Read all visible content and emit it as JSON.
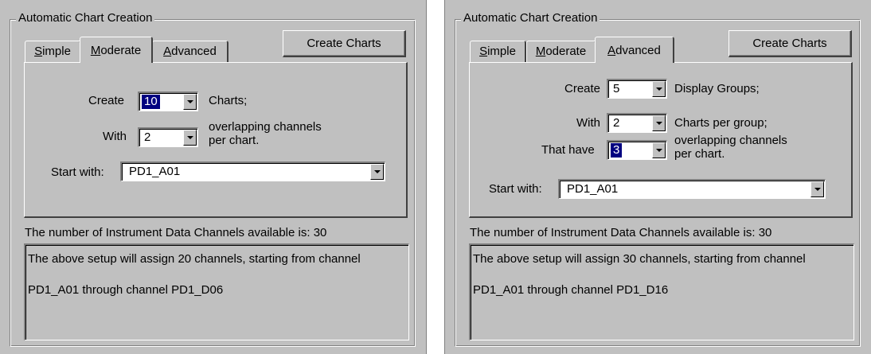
{
  "panels": [
    {
      "group_title": "Automatic Chart Creation",
      "tabs": [
        {
          "pre": "",
          "ul": "S",
          "post": "imple"
        },
        {
          "pre": "",
          "ul": "M",
          "post": "oderate"
        },
        {
          "pre": "",
          "ul": "A",
          "post": "dvanced"
        }
      ],
      "active_tab": "Moderate",
      "create_button": "Create Charts",
      "rows": {
        "create_label": "Create",
        "create_value": "10",
        "create_suffix": "Charts;",
        "with_label": "With",
        "with_value": "2",
        "with_suffix_line1": "overlapping channels",
        "with_suffix_line2": "per chart.",
        "start_label": "Start with:",
        "start_value": "PD1_A01"
      },
      "status": "The number of Instrument Data Channels available is: 30",
      "summary_line1": "The above setup will assign 20 channels, starting from channel",
      "summary_line2": "PD1_A01 through channel PD1_D06"
    },
    {
      "group_title": "Automatic Chart Creation",
      "tabs": [
        {
          "pre": "",
          "ul": "S",
          "post": "imple"
        },
        {
          "pre": "",
          "ul": "M",
          "post": "oderate"
        },
        {
          "pre": "",
          "ul": "A",
          "post": "dvanced"
        }
      ],
      "active_tab": "Advanced",
      "create_button": "Create Charts",
      "rows": {
        "create_label": "Create",
        "create_value": "5",
        "create_suffix": "Display Groups;",
        "with_label": "With",
        "with_value": "2",
        "with_suffix": "Charts per group;",
        "have_label": "That have",
        "have_value": "3",
        "have_suffix_line1": "overlapping channels",
        "have_suffix_line2": "per chart.",
        "start_label": "Start with:",
        "start_value": "PD1_A01"
      },
      "status": "The number of Instrument Data Channels available is: 30",
      "summary_line1": "The above setup will assign 30 channels, starting from channel",
      "summary_line2": "PD1_A01 through channel PD1_D16"
    }
  ]
}
